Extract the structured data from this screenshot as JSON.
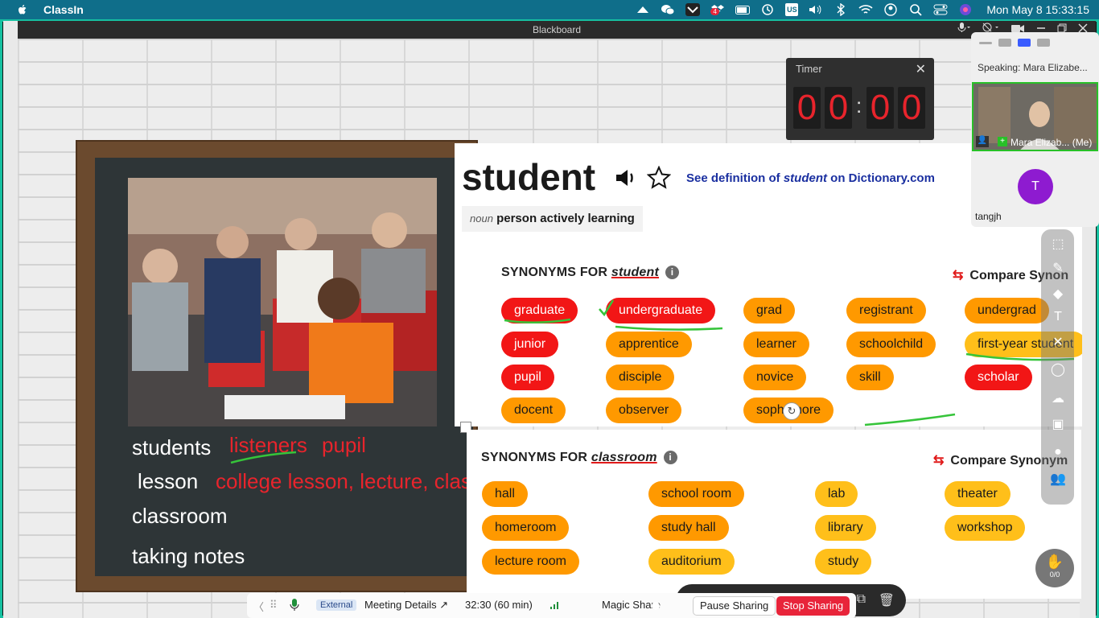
{
  "menubar": {
    "app_name": "ClassIn",
    "clock": "Mon May 8  15:33:15",
    "input_source": "US",
    "notification_count": "4"
  },
  "window": {
    "title": "Blackboard"
  },
  "timer": {
    "title": "Timer",
    "digits": [
      "0",
      "0",
      "0",
      "0"
    ],
    "separator": ":"
  },
  "video_panel": {
    "speaking": "Speaking: Mara Elizabe...",
    "cam_name": "Mara Elizab... (Me)",
    "avatar_letter": "T",
    "participant": "tangjh"
  },
  "chalkboard": {
    "line1": "students",
    "line1_red": [
      "listeners",
      "pupil"
    ],
    "line2": "lesson",
    "line2_red": "college lesson, lecture, clas",
    "line3": "classroom",
    "line4": "taking notes"
  },
  "dictionary": {
    "word": "student",
    "see_def_prefix": "See definition of ",
    "see_def_word": "student",
    "see_def_suffix": " on Dictionary.com",
    "pos": "noun",
    "definition": "person actively learning",
    "syn_heading_prefix": "SYNONYMS FOR ",
    "syn_keyword": "student",
    "compare": "Compare Synon",
    "synonyms": [
      {
        "label": "graduate",
        "level": "red"
      },
      {
        "label": "undergraduate",
        "level": "red"
      },
      {
        "label": "grad",
        "level": "orange"
      },
      {
        "label": "registrant",
        "level": "orange"
      },
      {
        "label": "undergrad",
        "level": "orange"
      },
      {
        "label": "junior",
        "level": "red"
      },
      {
        "label": "apprentice",
        "level": "orange"
      },
      {
        "label": "learner",
        "level": "orange"
      },
      {
        "label": "schoolchild",
        "level": "orange"
      },
      {
        "label": "first-year student",
        "level": "yellow"
      },
      {
        "label": "pupil",
        "level": "red"
      },
      {
        "label": "disciple",
        "level": "orange"
      },
      {
        "label": "novice",
        "level": "orange"
      },
      {
        "label": "skill",
        "level": "orange"
      },
      {
        "label": "scholar",
        "level": "red"
      },
      {
        "label": "docent",
        "level": "orange"
      },
      {
        "label": "observer",
        "level": "orange"
      },
      {
        "label": "sophomore",
        "level": "orange"
      }
    ]
  },
  "dictionary2": {
    "syn_heading_prefix": "SYNONYMS FOR ",
    "syn_keyword": "classroom",
    "compare": "Compare Synonym",
    "synonyms": [
      {
        "label": "hall",
        "level": "orange"
      },
      {
        "label": "school room",
        "level": "orange"
      },
      {
        "label": "lab",
        "level": "yellow"
      },
      {
        "label": "theater",
        "level": "yellow"
      },
      {
        "label": "homeroom",
        "level": "orange"
      },
      {
        "label": "study hall",
        "level": "orange"
      },
      {
        "label": "library",
        "level": "yellow"
      },
      {
        "label": "workshop",
        "level": "yellow"
      },
      {
        "label": "lecture room",
        "level": "orange"
      },
      {
        "label": "auditorium",
        "level": "yellow"
      },
      {
        "label": "study",
        "level": "yellow"
      }
    ]
  },
  "sharebar": {
    "external": "External",
    "meeting_details": "Meeting Details",
    "elapsed": "32:30  (60 min)",
    "magic_share": "Magic Share",
    "pause": "Pause Sharing",
    "stop": "Stop Sharing"
  },
  "hand": {
    "count": "0/0"
  },
  "colors": {
    "red": "#f21616",
    "orange": "#ff9900",
    "yellow": "#ffbf1a",
    "menubar": "#0f6e8a",
    "frame": "#16c0a0"
  }
}
